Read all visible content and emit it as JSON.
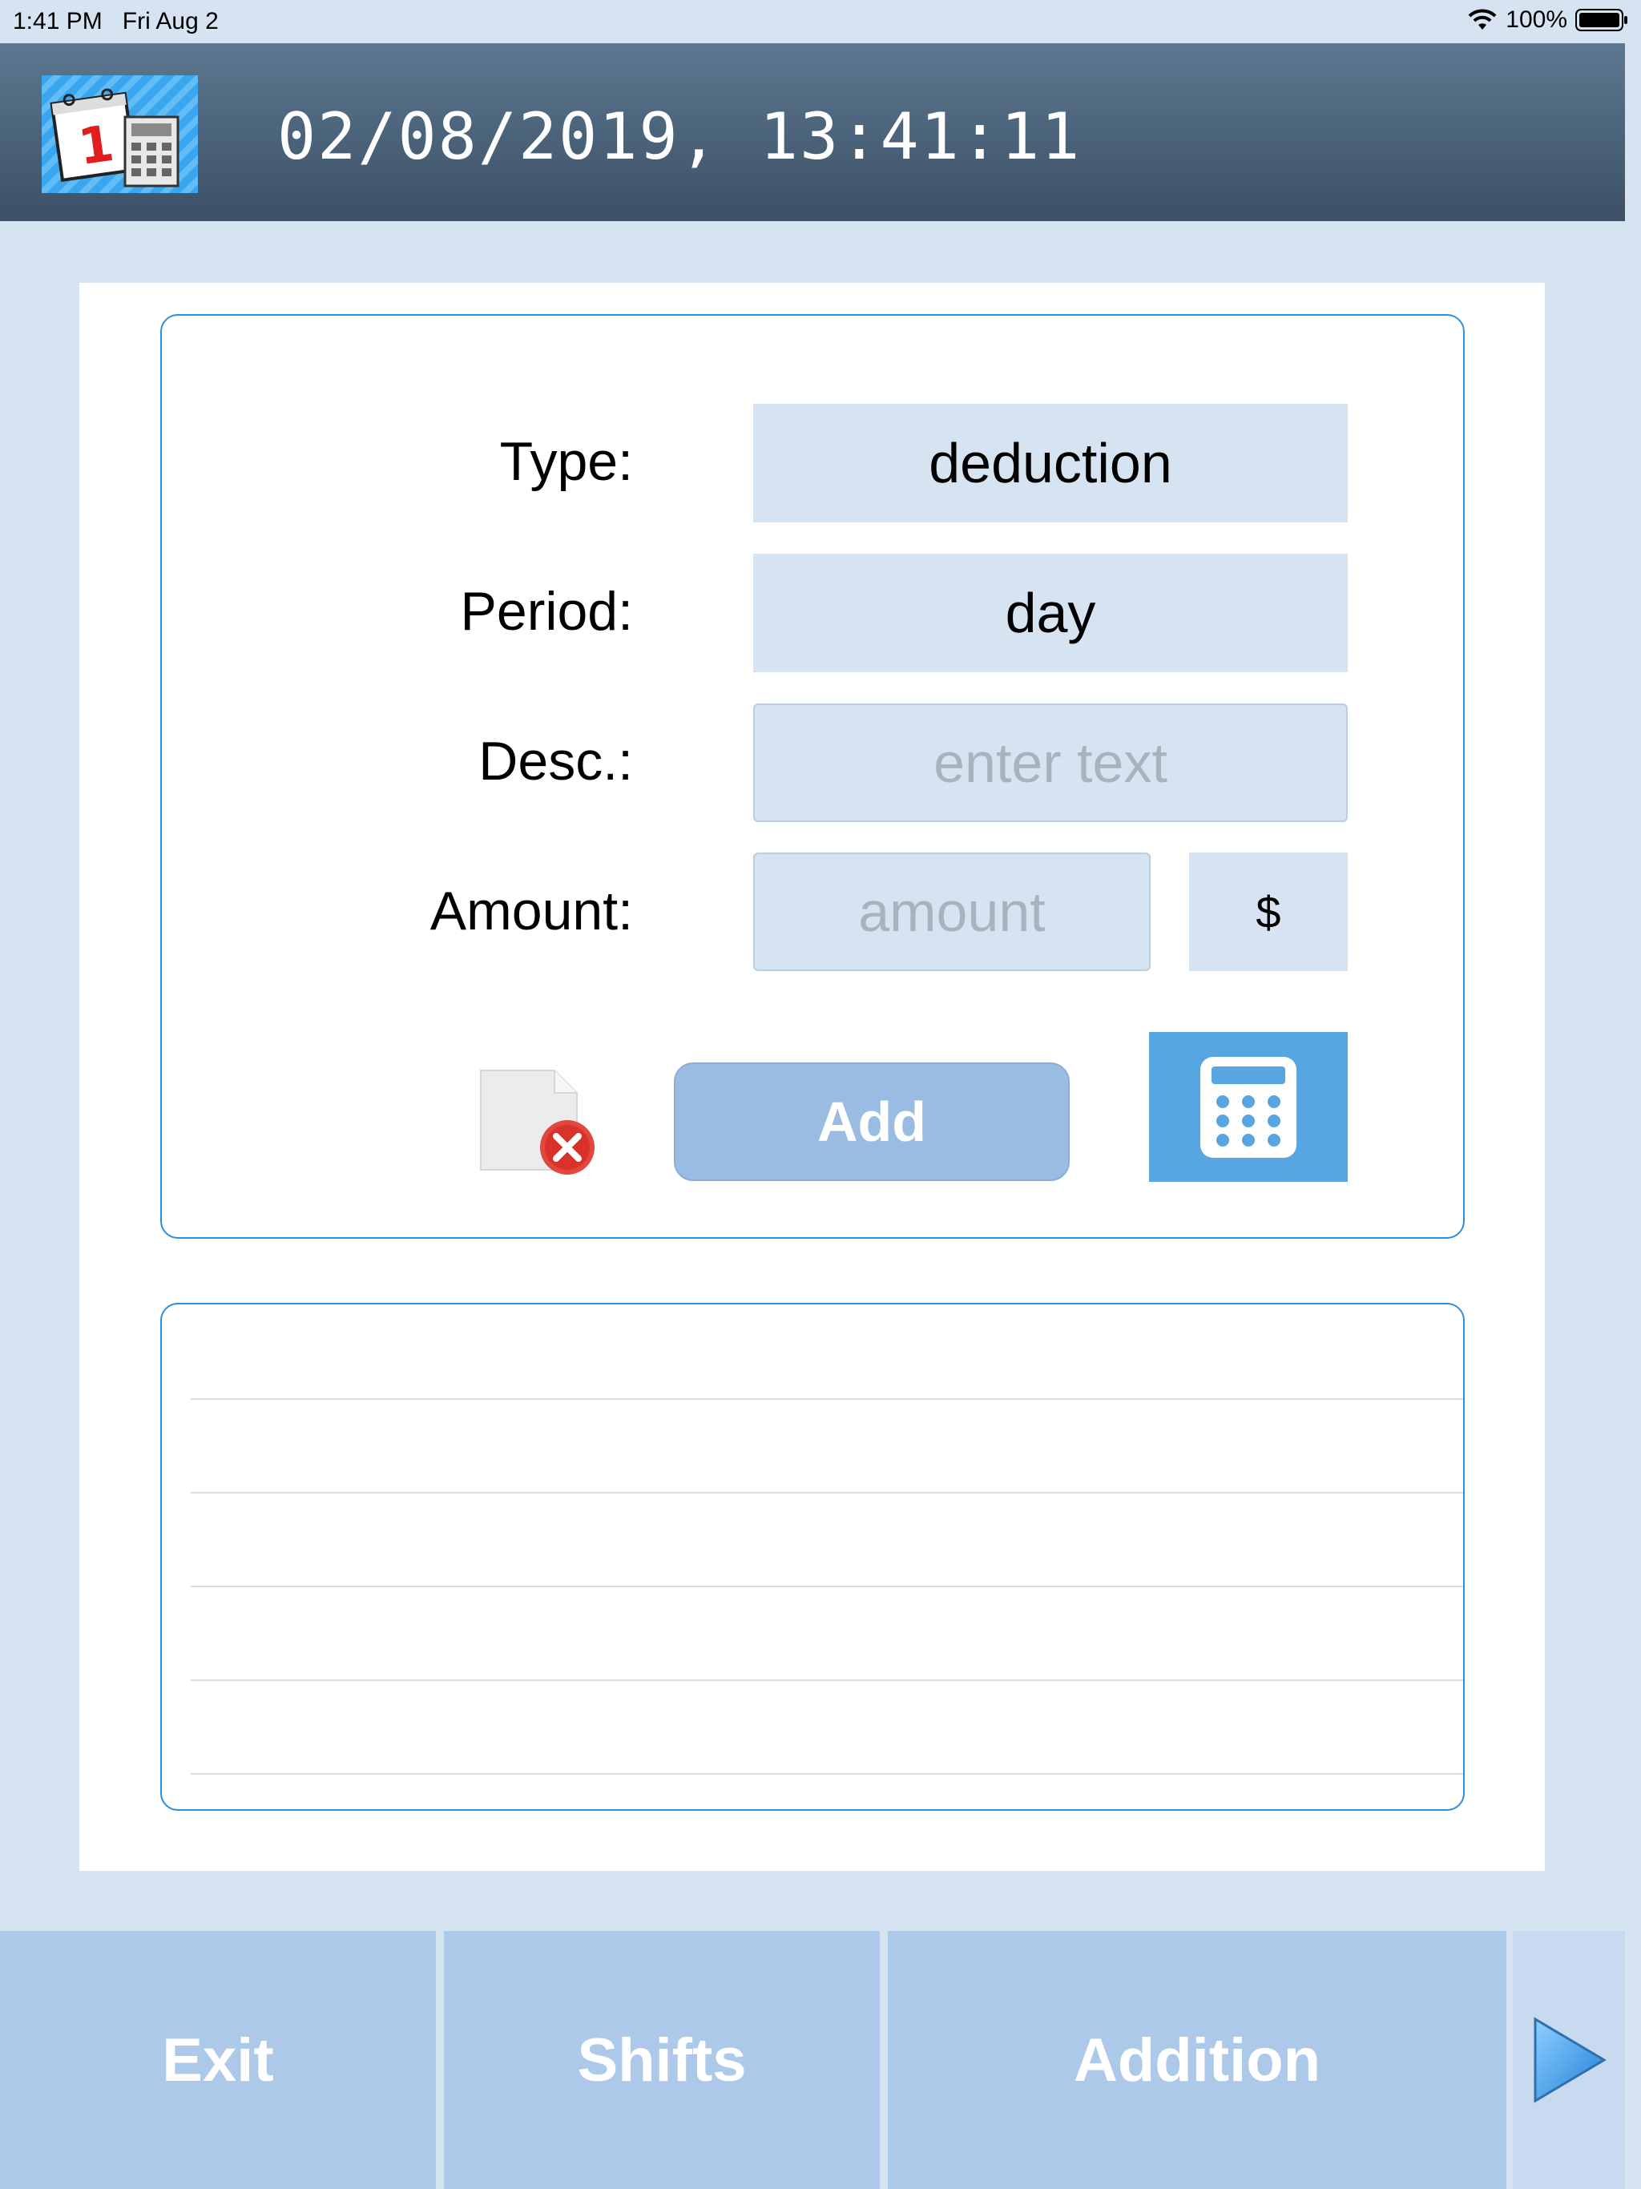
{
  "status_bar": {
    "time": "1:41 PM",
    "date": "Fri Aug 2",
    "battery": "100%"
  },
  "header": {
    "title": "02/08/2019, 13:41:11",
    "app_icon": "calendar-calculator-icon"
  },
  "form": {
    "type_label": "Type:",
    "type_value": "deduction",
    "period_label": "Period:",
    "period_value": "day",
    "desc_label": "Desc.:",
    "desc_placeholder": "enter text",
    "amount_label": "Amount:",
    "amount_placeholder": "amount",
    "currency": "$",
    "add_label": "Add"
  },
  "list": {
    "rows": 5
  },
  "bottom_nav": {
    "exit_label": "Exit",
    "shifts_label": "Shifts",
    "addition_label": "Addition"
  },
  "colors": {
    "background": "#d6e4f2",
    "header": "#4a6178",
    "accent": "#2a8fe0",
    "button": "#9bbce2",
    "calculator": "#57a5e1"
  }
}
